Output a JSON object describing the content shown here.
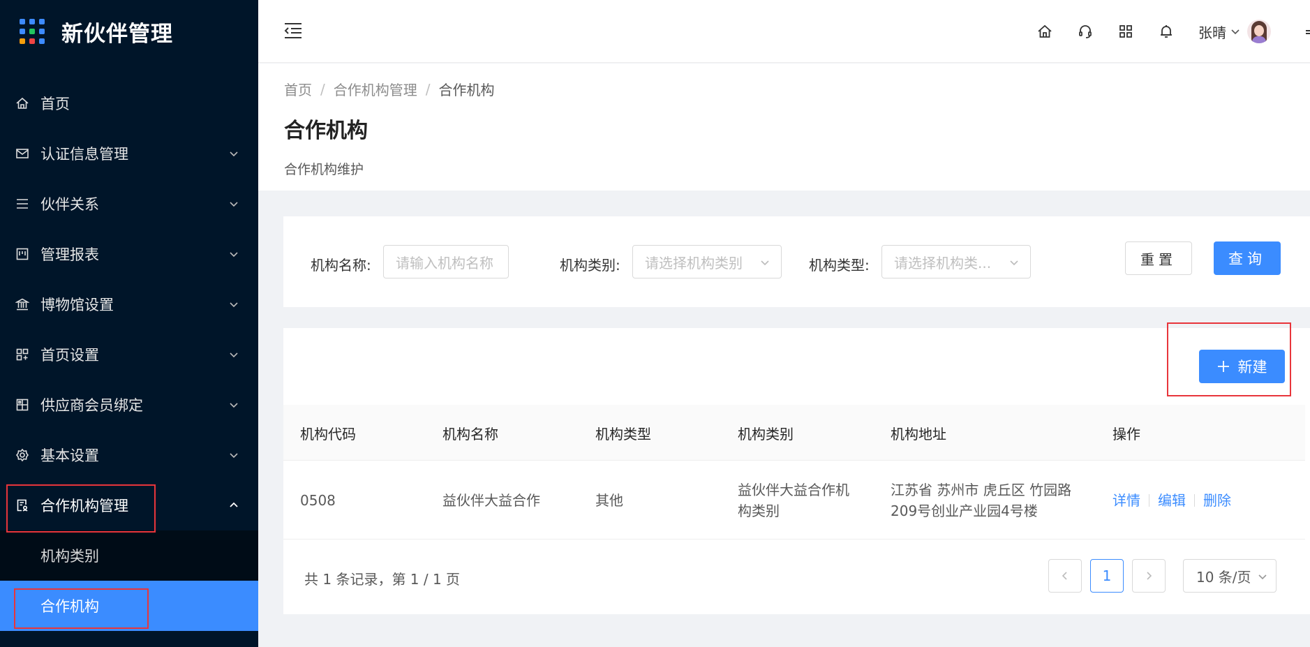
{
  "app": {
    "title": "新伙伴管理"
  },
  "sidebar": {
    "items": [
      {
        "label": "首页",
        "icon": "home-icon"
      },
      {
        "label": "认证信息管理",
        "icon": "mail-icon"
      },
      {
        "label": "伙伴关系",
        "icon": "list-icon"
      },
      {
        "label": "管理报表",
        "icon": "report-icon"
      },
      {
        "label": "博物馆设置",
        "icon": "bank-icon"
      },
      {
        "label": "首页设置",
        "icon": "appstore-icon"
      },
      {
        "label": "供应商会员绑定",
        "icon": "build-icon"
      },
      {
        "label": "基本设置",
        "icon": "setting-icon"
      },
      {
        "label": "合作机构管理",
        "icon": "audit-icon"
      }
    ],
    "submenu": [
      {
        "label": "机构类别"
      },
      {
        "label": "合作机构"
      }
    ]
  },
  "header": {
    "user_name": "张晴"
  },
  "breadcrumb": {
    "home": "首页",
    "parent": "合作机构管理",
    "current": "合作机构",
    "separator": "/"
  },
  "page": {
    "title": "合作机构",
    "description": "合作机构维护"
  },
  "filters": {
    "name_label": "机构名称:",
    "name_placeholder": "请输入机构名称",
    "category_label": "机构类别:",
    "category_placeholder": "请选择机构类别",
    "type_label": "机构类型:",
    "type_placeholder": "请选择机构类...",
    "reset_label": "重置",
    "query_label": "查询"
  },
  "toolbar": {
    "new_label": "新建"
  },
  "table": {
    "columns": [
      "机构代码",
      "机构名称",
      "机构类型",
      "机构类别",
      "机构地址",
      "操作"
    ],
    "rows": [
      {
        "code": "0508",
        "name": "益伙伴大益合作",
        "type": "其他",
        "category_line1": "益伙伴大益合作机",
        "category_line2": "构类别",
        "address_line1": "江苏省 苏州市 虎丘区 竹园路",
        "address_line2": "209号创业产业园4号楼",
        "actions": {
          "detail": "详情",
          "edit": "编辑",
          "delete": "删除"
        }
      }
    ]
  },
  "pagination": {
    "summary": "共 1 条记录，第 1 / 1 页",
    "current_page": "1",
    "page_size": "10 条/页",
    "prev": "<",
    "next": ">"
  },
  "colors": {
    "sidebar_bg": "#001529",
    "accent": "#3b8cff",
    "highlight_box": "#e8353b"
  }
}
